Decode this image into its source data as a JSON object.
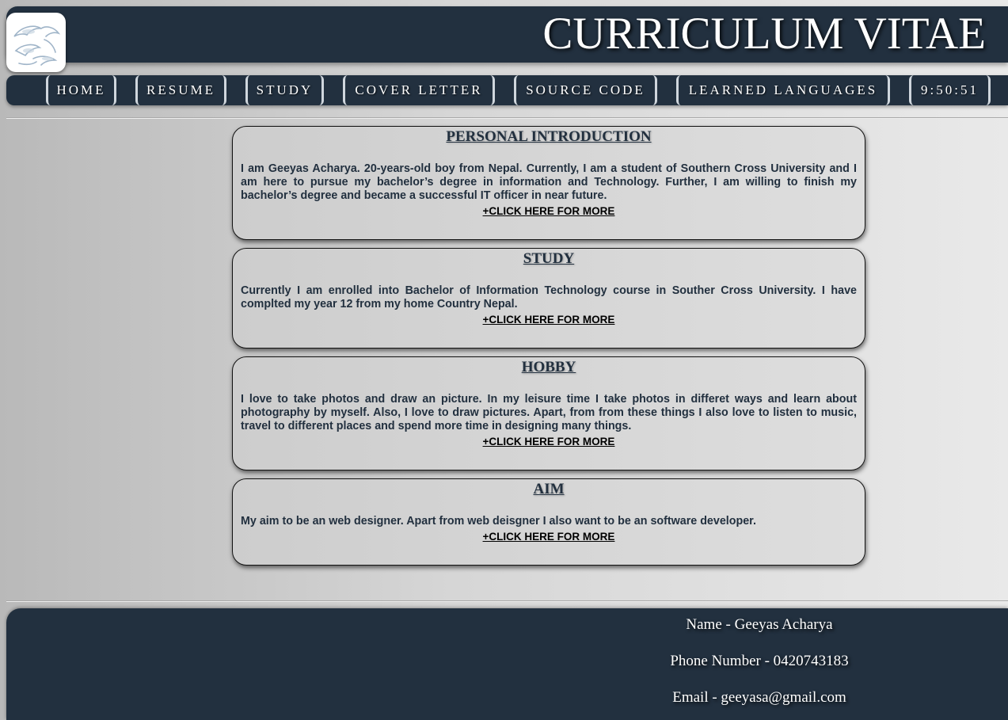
{
  "header": {
    "title": "CURRICULUM VITAE",
    "logo_icon": "dolphins-logo-icon"
  },
  "nav": {
    "items": [
      {
        "label": "HOME"
      },
      {
        "label": "RESUME"
      },
      {
        "label": "STUDY"
      },
      {
        "label": "COVER LETTER"
      },
      {
        "label": "SOURCE CODE"
      },
      {
        "label": "LEARNED LANGUAGES"
      }
    ],
    "clock": "9:50:51"
  },
  "sections": [
    {
      "heading": "PERSONAL INTRODUCTION",
      "body": "I am Geeyas Acharya. 20-years-old boy from Nepal. Currently, I am a student of Southern Cross University and I am here to pursue my bachelor’s degree in information and Technology. Further, I am willing to finish my bachelor’s degree and became a successful IT officer in near future.",
      "more": "+CLICK HERE FOR MORE"
    },
    {
      "heading": "STUDY",
      "body": "Currently I am enrolled into Bachelor of Information Technology course in Souther Cross University. I have complted my year 12 from my home Country Nepal.",
      "more": "+CLICK HERE FOR MORE"
    },
    {
      "heading": "HOBBY",
      "body": "I love to take photos and draw an picture. In my leisure time I take photos in differet ways and learn about photography by myself. Also, I love to draw pictures. Apart, from from these things I also love to listen to music, travel to different places and spend more time in designing many things.",
      "more": "+CLICK HERE FOR MORE"
    },
    {
      "heading": "AIM",
      "body": "My aim to be an web designer. Apart from web deisgner I also want to be an software developer.",
      "more": "+CLICK HERE FOR MORE"
    }
  ],
  "footer": {
    "name": "Name - Geeyas Acharya",
    "phone": "Phone Number - 0420743183",
    "email": "Email - geeyasa@gmail.com"
  },
  "colors": {
    "primary": "#22303f",
    "background_light": "#e9e9e9",
    "background_dark": "#b9b9b9",
    "text_on_primary": "#ffffff"
  }
}
